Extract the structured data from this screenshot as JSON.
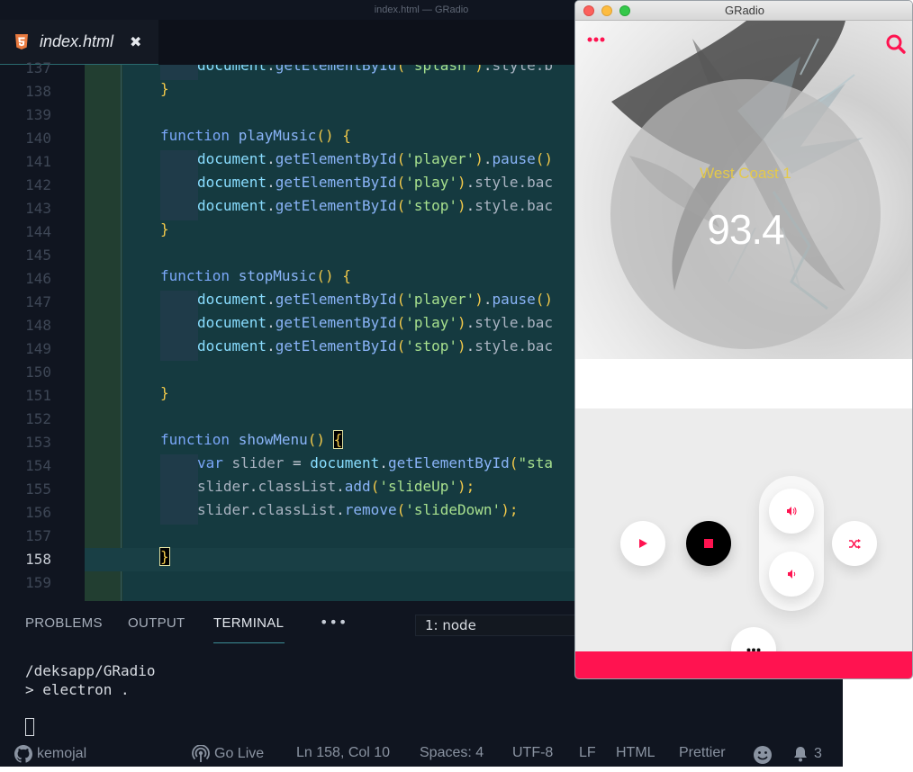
{
  "editor": {
    "window_title": "index.html — GRadio",
    "tab": {
      "icon": "html5-icon",
      "filename": "index.html",
      "close": "✖"
    },
    "lines": [
      {
        "num": "137",
        "indent": "        ",
        "tokens": [
          {
            "t": "document",
            "c": "obj"
          },
          {
            "t": ".",
            "c": "plain"
          },
          {
            "t": "getElementById",
            "c": "fn"
          },
          {
            "t": "(",
            "c": "pr"
          },
          {
            "t": "'splash'",
            "c": "str"
          },
          {
            "t": ")",
            "c": "pr"
          },
          {
            "t": ".",
            "c": "plain"
          },
          {
            "t": "style",
            "c": "prop"
          },
          {
            "t": ".b",
            "c": "prop"
          }
        ]
      },
      {
        "num": "138",
        "indent": "    ",
        "tokens": [
          {
            "t": "}",
            "c": "pr"
          }
        ]
      },
      {
        "num": "139",
        "indent": "",
        "tokens": []
      },
      {
        "num": "140",
        "indent": "    ",
        "tokens": [
          {
            "t": "function ",
            "c": "kw"
          },
          {
            "t": "playMusic",
            "c": "fn"
          },
          {
            "t": "() {",
            "c": "pr"
          }
        ]
      },
      {
        "num": "141",
        "indent": "        ",
        "tokens": [
          {
            "t": "document",
            "c": "obj"
          },
          {
            "t": ".",
            "c": "plain"
          },
          {
            "t": "getElementById",
            "c": "fn"
          },
          {
            "t": "(",
            "c": "pr"
          },
          {
            "t": "'player'",
            "c": "str"
          },
          {
            "t": ")",
            "c": "pr"
          },
          {
            "t": ".",
            "c": "plain"
          },
          {
            "t": "pause",
            "c": "fn"
          },
          {
            "t": "()",
            "c": "pr"
          }
        ]
      },
      {
        "num": "142",
        "indent": "        ",
        "tokens": [
          {
            "t": "document",
            "c": "obj"
          },
          {
            "t": ".",
            "c": "plain"
          },
          {
            "t": "getElementById",
            "c": "fn"
          },
          {
            "t": "(",
            "c": "pr"
          },
          {
            "t": "'play'",
            "c": "str"
          },
          {
            "t": ")",
            "c": "pr"
          },
          {
            "t": ".",
            "c": "plain"
          },
          {
            "t": "style",
            "c": "prop"
          },
          {
            "t": ".bac",
            "c": "prop"
          }
        ]
      },
      {
        "num": "143",
        "indent": "        ",
        "tokens": [
          {
            "t": "document",
            "c": "obj"
          },
          {
            "t": ".",
            "c": "plain"
          },
          {
            "t": "getElementById",
            "c": "fn"
          },
          {
            "t": "(",
            "c": "pr"
          },
          {
            "t": "'stop'",
            "c": "str"
          },
          {
            "t": ")",
            "c": "pr"
          },
          {
            "t": ".",
            "c": "plain"
          },
          {
            "t": "style",
            "c": "prop"
          },
          {
            "t": ".bac",
            "c": "prop"
          }
        ]
      },
      {
        "num": "144",
        "indent": "    ",
        "tokens": [
          {
            "t": "}",
            "c": "pr"
          }
        ]
      },
      {
        "num": "145",
        "indent": "",
        "tokens": []
      },
      {
        "num": "146",
        "indent": "    ",
        "tokens": [
          {
            "t": "function ",
            "c": "kw"
          },
          {
            "t": "stopMusic",
            "c": "fn"
          },
          {
            "t": "() {",
            "c": "pr"
          }
        ]
      },
      {
        "num": "147",
        "indent": "        ",
        "tokens": [
          {
            "t": "document",
            "c": "obj"
          },
          {
            "t": ".",
            "c": "plain"
          },
          {
            "t": "getElementById",
            "c": "fn"
          },
          {
            "t": "(",
            "c": "pr"
          },
          {
            "t": "'player'",
            "c": "str"
          },
          {
            "t": ")",
            "c": "pr"
          },
          {
            "t": ".",
            "c": "plain"
          },
          {
            "t": "pause",
            "c": "fn"
          },
          {
            "t": "()",
            "c": "pr"
          }
        ]
      },
      {
        "num": "148",
        "indent": "        ",
        "tokens": [
          {
            "t": "document",
            "c": "obj"
          },
          {
            "t": ".",
            "c": "plain"
          },
          {
            "t": "getElementById",
            "c": "fn"
          },
          {
            "t": "(",
            "c": "pr"
          },
          {
            "t": "'play'",
            "c": "str"
          },
          {
            "t": ")",
            "c": "pr"
          },
          {
            "t": ".",
            "c": "plain"
          },
          {
            "t": "style",
            "c": "prop"
          },
          {
            "t": ".bac",
            "c": "prop"
          }
        ]
      },
      {
        "num": "149",
        "indent": "        ",
        "tokens": [
          {
            "t": "document",
            "c": "obj"
          },
          {
            "t": ".",
            "c": "plain"
          },
          {
            "t": "getElementById",
            "c": "fn"
          },
          {
            "t": "(",
            "c": "pr"
          },
          {
            "t": "'stop'",
            "c": "str"
          },
          {
            "t": ")",
            "c": "pr"
          },
          {
            "t": ".",
            "c": "plain"
          },
          {
            "t": "style",
            "c": "prop"
          },
          {
            "t": ".bac",
            "c": "prop"
          }
        ]
      },
      {
        "num": "150",
        "indent": "",
        "tokens": []
      },
      {
        "num": "151",
        "indent": "    ",
        "tokens": [
          {
            "t": "}",
            "c": "pr"
          }
        ]
      },
      {
        "num": "152",
        "indent": "",
        "tokens": []
      },
      {
        "num": "153",
        "indent": "    ",
        "tokens": [
          {
            "t": "function ",
            "c": "kw"
          },
          {
            "t": "showMenu",
            "c": "fn"
          },
          {
            "t": "() ",
            "c": "pr"
          },
          {
            "t": "{",
            "c": "pr match"
          }
        ]
      },
      {
        "num": "154",
        "indent": "        ",
        "tokens": [
          {
            "t": "var ",
            "c": "kw"
          },
          {
            "t": "slider ",
            "c": "prop"
          },
          {
            "t": "= ",
            "c": "plain"
          },
          {
            "t": "document",
            "c": "obj"
          },
          {
            "t": ".",
            "c": "plain"
          },
          {
            "t": "getElementById",
            "c": "fn"
          },
          {
            "t": "(",
            "c": "pr"
          },
          {
            "t": "\"sta",
            "c": "str"
          }
        ]
      },
      {
        "num": "155",
        "indent": "        ",
        "tokens": [
          {
            "t": "slider",
            "c": "prop"
          },
          {
            "t": ".",
            "c": "plain"
          },
          {
            "t": "classList",
            "c": "prop"
          },
          {
            "t": ".",
            "c": "plain"
          },
          {
            "t": "add",
            "c": "fn"
          },
          {
            "t": "(",
            "c": "pr"
          },
          {
            "t": "'slideUp'",
            "c": "str"
          },
          {
            "t": ");",
            "c": "pr"
          }
        ]
      },
      {
        "num": "156",
        "indent": "        ",
        "tokens": [
          {
            "t": "slider",
            "c": "prop"
          },
          {
            "t": ".",
            "c": "plain"
          },
          {
            "t": "classList",
            "c": "prop"
          },
          {
            "t": ".",
            "c": "plain"
          },
          {
            "t": "remove",
            "c": "fn"
          },
          {
            "t": "(",
            "c": "pr"
          },
          {
            "t": "'slideDown'",
            "c": "str"
          },
          {
            "t": ");",
            "c": "pr"
          }
        ]
      },
      {
        "num": "157",
        "indent": "",
        "tokens": []
      },
      {
        "num": "158",
        "indent": "    ",
        "tokens": [
          {
            "t": "}",
            "c": "pr match"
          }
        ]
      },
      {
        "num": "159",
        "indent": "",
        "tokens": []
      }
    ],
    "active_line": "158",
    "panel": {
      "tabs": [
        "PROBLEMS",
        "OUTPUT",
        "TERMINAL"
      ],
      "selected_tab": "TERMINAL",
      "more": "•••",
      "terminal_select": "1: node",
      "terminal_lines": [
        "/deksapp/GRadio",
        "> electron ."
      ]
    },
    "status": {
      "user": "kemojal",
      "go_live": "Go Live",
      "position": "Ln 158, Col 10",
      "spaces": "Spaces: 4",
      "encoding": "UTF-8",
      "eol": "LF",
      "language": "HTML",
      "formatter": "Prettier",
      "notifications": "3"
    }
  },
  "gradio": {
    "window_title": "GRadio",
    "station": "West Coast 1",
    "frequency": "93.4",
    "accent": "#ff1350",
    "station_color": "#e4c94a"
  }
}
